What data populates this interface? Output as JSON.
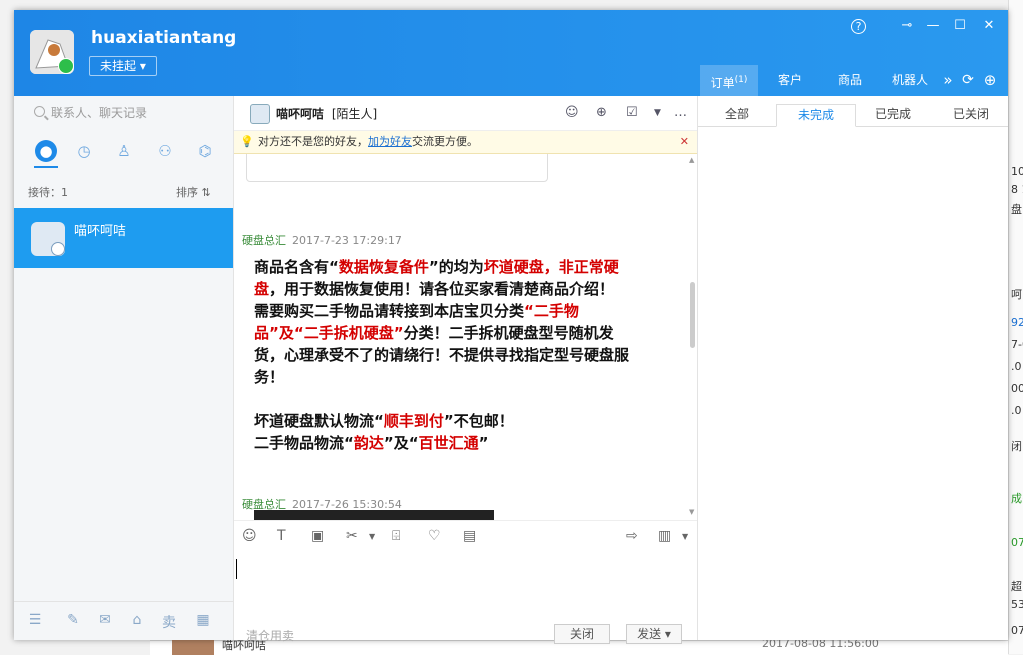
{
  "profile": {
    "username": "huaxiatiantang",
    "status": "未挂起 ▾"
  },
  "window_controls": [
    "?",
    "⊸",
    "—",
    "☐",
    "✕"
  ],
  "top_tabs": [
    {
      "label": "订单",
      "badge": "(1)"
    },
    {
      "label": "客户",
      "badge": ""
    },
    {
      "label": "商品",
      "badge": ""
    },
    {
      "label": "机器人",
      "badge": ""
    }
  ],
  "top_more": "»",
  "sidebar": {
    "search_placeholder": "联系人、聊天记录",
    "reception_count": "接待：1",
    "sort_label": "排序 ⇅",
    "contacts": [
      {
        "name": "喵吥呵咭"
      }
    ]
  },
  "chat": {
    "contact_name": "喵吥呵咭",
    "contact_tag": "[陌生人]",
    "notice_before": "对方还不是您的好友，",
    "notice_link": "加为好友",
    "notice_after": "交流更方便。",
    "messages": [
      {
        "sender": "硬盘总汇",
        "time": "2017-7-23 17:29:17",
        "parts": [
          {
            "t": "商品名含有“",
            "red": false
          },
          {
            "t": "数据恢复备件",
            "red": true
          },
          {
            "t": "”的均为",
            "red": false
          },
          {
            "t": "坏道硬盘，非正常硬盘",
            "red": true
          },
          {
            "t": "，用于数据恢复使用！请各位买家看清楚商品介绍！",
            "red": false
          },
          {
            "t": "\n需要购买二手物品请转接到本店宝贝分类",
            "red": false
          },
          {
            "t": "“二手物品”及“二手拆机硬盘”",
            "red": true
          },
          {
            "t": "分类！二手拆机硬盘型号随机发货，心理承受不了的请绕行！不提供寻找指定型号硬盘服务！",
            "red": false
          },
          {
            "t": "\n\n坏道硬盘默认物流“",
            "red": false
          },
          {
            "t": "顺丰到付",
            "red": true
          },
          {
            "t": "”不包邮！\n二手物品物流“",
            "red": false
          },
          {
            "t": "韵达",
            "red": true
          },
          {
            "t": "”及“",
            "red": false
          },
          {
            "t": "百世汇通",
            "red": true
          },
          {
            "t": "”",
            "red": false
          }
        ]
      },
      {
        "sender": "硬盘总汇",
        "time": "2017-7-26 15:30:54"
      }
    ],
    "quick_phrase": "清仓用卖",
    "close_label": "关闭",
    "send_label": "发送 ▾"
  },
  "right": {
    "sub_tabs": [
      "全部",
      "未完成",
      "已完成",
      "已关闭"
    ],
    "active_sub_tab": 1
  },
  "background": {
    "bottom_name": "喵吥呵咭",
    "bottom_date": "2017-08-08 11:56:00",
    "edge_snippets": [
      "10",
      "8 1",
      "盘",
      "呵",
      "92",
      "7-0",
      ".0",
      "00",
      ".0",
      "闭：",
      "成(",
      "07",
      "超",
      "53",
      "07"
    ]
  },
  "colors": {
    "header": "#1e86e6",
    "accent": "#1e8ae8",
    "selected_contact": "#1e9cf0",
    "warn_red": "#d40000",
    "sender_green": "#3a8c3a"
  }
}
